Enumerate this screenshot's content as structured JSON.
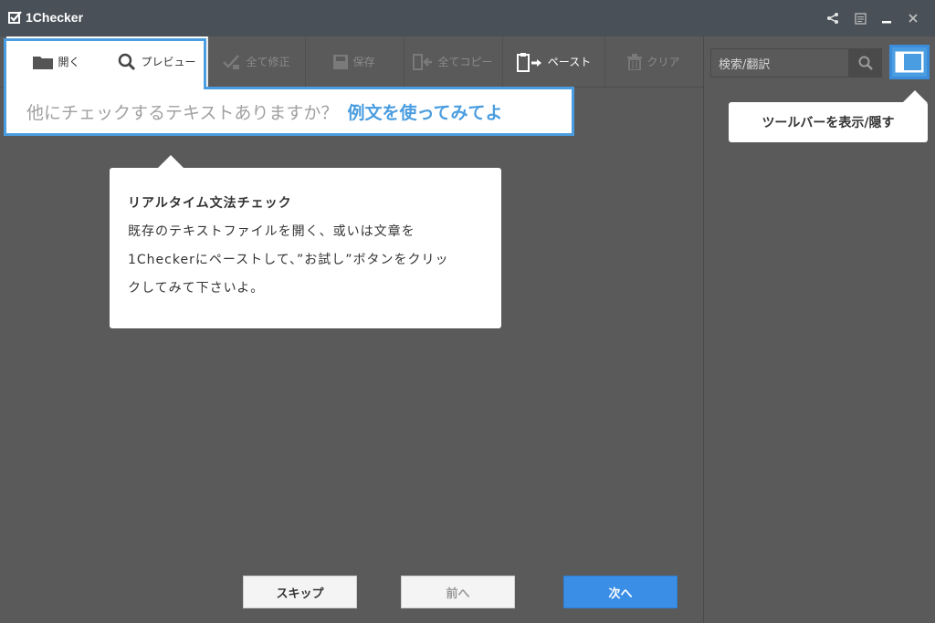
{
  "window": {
    "title": "1Checker",
    "icons": [
      "share-icon",
      "notes-icon",
      "minimize-icon",
      "close-icon"
    ]
  },
  "toolbar": {
    "open_label": "開く",
    "preview_label": "プレビュー",
    "fix_all_label": "全て修正",
    "save_label": "保存",
    "copy_all_label": "全てコピー",
    "paste_label": "ペースト",
    "clear_label": "クリア"
  },
  "hint": {
    "text": "他にチェックするテキストありますか？",
    "link": "例文を使ってみてよ"
  },
  "search": {
    "placeholder": "検索/翻訳"
  },
  "tooltips": {
    "toggle": "ツールバーを表示/隠す",
    "main_title": "リアルタイム文法チェック",
    "main_line1": "既存のテキストファイルを開く、或いは文章を",
    "main_line2": "1Checkerにペーストして、”お試し”ボタンをクリッ",
    "main_line3": "クしてみて下さいよ。"
  },
  "nav": {
    "skip_label": "スキップ",
    "prev_label": "前へ",
    "next_label": "次へ"
  },
  "colors": {
    "accent": "#4a9de0",
    "titlebar": "#495057",
    "background": "#5a5a5a",
    "primary_button": "#3a8ee6"
  }
}
